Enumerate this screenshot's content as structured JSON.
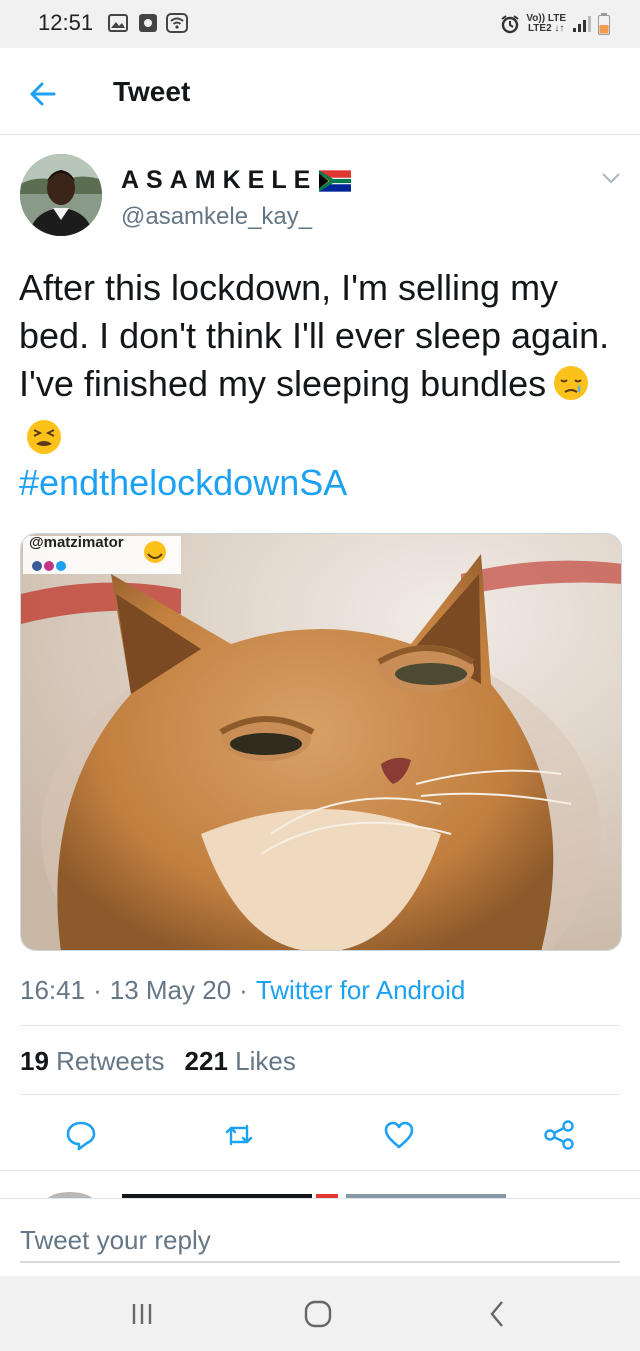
{
  "status_bar": {
    "time": "12:51",
    "icons": [
      "gallery-icon",
      "app-icon",
      "wifi-icon",
      "alarm-icon",
      "signal-icon",
      "battery-icon"
    ],
    "lte_top": "Vo)) LTE",
    "lte_bottom": "LTE2 ↓↑"
  },
  "header": {
    "title": "Tweet",
    "back_icon": "arrow-left-icon"
  },
  "tweet": {
    "display_name": "ASAMKELE",
    "handle": "@asamkele_kay_",
    "text": "After this lockdown, I'm selling my bed. I don't think I'll ever sleep again. I've finished my sleeping bundles",
    "hashtag": "#endthelockdownSA",
    "media_watermark": "@matzimator",
    "time": "16:41",
    "date": "13 May 20",
    "source": "Twitter for Android",
    "retweets_count": "19",
    "retweets_label": "Retweets",
    "likes_count": "221",
    "likes_label": "Likes"
  },
  "reply": {
    "placeholder": "Tweet your reply"
  },
  "colors": {
    "accent": "#1da1f2",
    "secondary_text": "#657786",
    "divider": "#e1e8ed"
  }
}
